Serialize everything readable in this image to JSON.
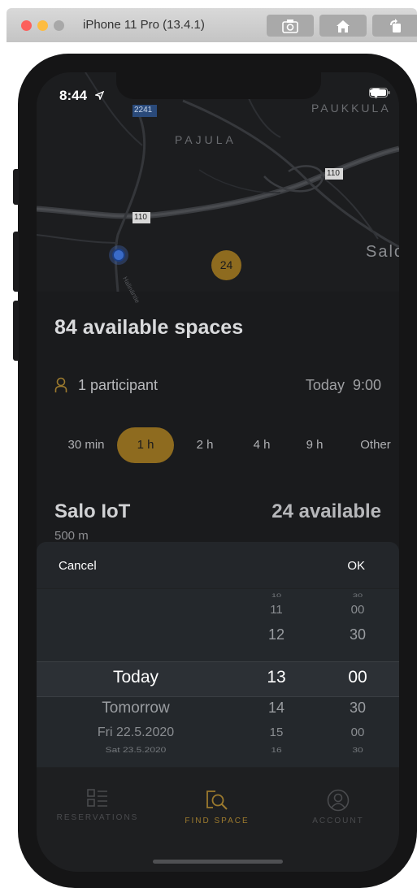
{
  "simulator": {
    "title": "iPhone 11 Pro (13.4.1)",
    "buttons": [
      {
        "icon": "screenshot-icon"
      },
      {
        "icon": "home-icon"
      },
      {
        "icon": "rotate-icon"
      }
    ]
  },
  "status_bar": {
    "time": "8:44"
  },
  "map": {
    "labels": {
      "pajula": "PAJULA",
      "paukkula": "PAUKKULA",
      "salo": "Salo",
      "road_2241": "2241",
      "road_110_a": "110",
      "road_110_b": "110",
      "street": "Halinäntie"
    },
    "cluster_count": "24"
  },
  "search": {
    "available_title": "84 available spaces",
    "participants": "1 participant",
    "date": "Today",
    "time": "9:00",
    "durations": [
      "30 min",
      "1 h",
      "2 h",
      "4 h",
      "9 h",
      "Other"
    ],
    "selected_duration": "1 h"
  },
  "space": {
    "name": "Salo IoT",
    "available": "24 available",
    "distance": "500 m"
  },
  "picker": {
    "cancel": "Cancel",
    "ok": "OK",
    "dates": [
      "Today",
      "Tomorrow",
      "Fri 22.5.2020",
      "Sat 23.5.2020"
    ],
    "hours": [
      "10",
      "11",
      "12",
      "13",
      "14",
      "15",
      "16"
    ],
    "minutes": [
      "30",
      "00",
      "30",
      "00",
      "30",
      "00",
      "30"
    ]
  },
  "tabs": [
    {
      "label": "RESERVATIONS",
      "icon": "reservations-icon"
    },
    {
      "label": "FIND SPACE",
      "icon": "find-space-icon"
    },
    {
      "label": "ACCOUNT",
      "icon": "account-icon"
    }
  ],
  "colors": {
    "accent": "#9c7a2e",
    "background": "#1a1b1d"
  }
}
